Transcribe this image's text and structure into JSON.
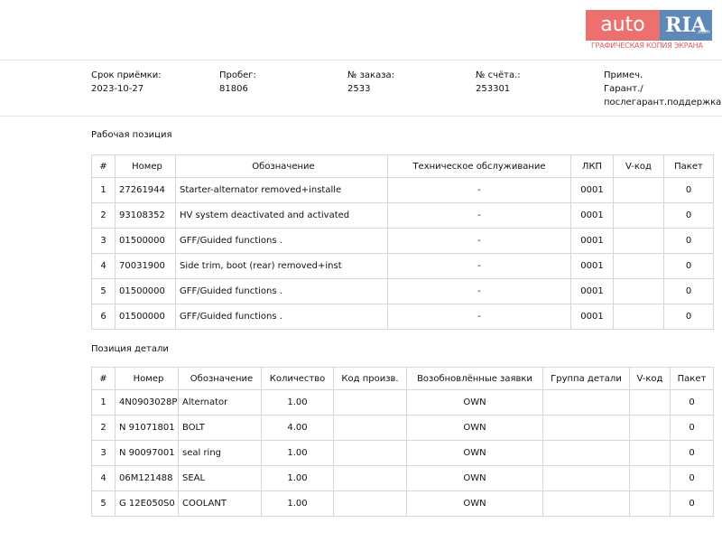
{
  "watermark": {
    "brand_left": "auto",
    "brand_right": "RIA",
    "brand_suffix": ".com",
    "caption": "ГРАФИЧЕСКАЯ КОПИЯ ЭКРАНА"
  },
  "meta": [
    {
      "label": "Срок приёмки:",
      "value": "2023-10-27"
    },
    {
      "label": "Пробег:",
      "value": "81806"
    },
    {
      "label": "№ заказа:",
      "value": "2533"
    },
    {
      "label": "№ счёта.:",
      "value": "253301"
    },
    {
      "label": "Примеч.",
      "value": "Гарант./",
      "value2": "послегарант.поддержка"
    }
  ],
  "work": {
    "title": "Рабочая позиция",
    "headers": [
      "#",
      "Номер",
      "Обозначение",
      "Техническое обслуживание",
      "ЛКП",
      "V-код",
      "Пакет"
    ],
    "rows": [
      [
        "1",
        "27261944",
        "Starter-alternator removed+installe",
        "-",
        "0001",
        "",
        "0"
      ],
      [
        "2",
        "93108352",
        "HV system deactivated and activated",
        "-",
        "0001",
        "",
        "0"
      ],
      [
        "3",
        "01500000",
        "GFF/Guided functions .",
        "-",
        "0001",
        "",
        "0"
      ],
      [
        "4",
        "70031900",
        "Side trim, boot (rear) removed+inst",
        "-",
        "0001",
        "",
        "0"
      ],
      [
        "5",
        "01500000",
        "GFF/Guided functions .",
        "-",
        "0001",
        "",
        "0"
      ],
      [
        "6",
        "01500000",
        "GFF/Guided functions .",
        "-",
        "0001",
        "",
        "0"
      ]
    ]
  },
  "parts": {
    "title": "Позиция детали",
    "headers": [
      "#",
      "Номер",
      "Обозначение",
      "Количество",
      "Код произв.",
      "Возобновлённые заявки",
      "Группа детали",
      "V-код",
      "Пакет"
    ],
    "rows": [
      [
        "1",
        "4N0903028P",
        "Alternator",
        "1.00",
        "",
        "OWN",
        "",
        "",
        "0"
      ],
      [
        "2",
        "N 91071801",
        "BOLT",
        "4.00",
        "",
        "OWN",
        "",
        "",
        "0"
      ],
      [
        "3",
        "N 90097001",
        "seal ring",
        "1.00",
        "",
        "OWN",
        "",
        "",
        "0"
      ],
      [
        "4",
        "06M121488",
        "SEAL",
        "1.00",
        "",
        "OWN",
        "",
        "",
        "0"
      ],
      [
        "5",
        "G 12E050S0",
        "COOLANT",
        "1.00",
        "",
        "OWN",
        "",
        "",
        "0"
      ]
    ]
  }
}
